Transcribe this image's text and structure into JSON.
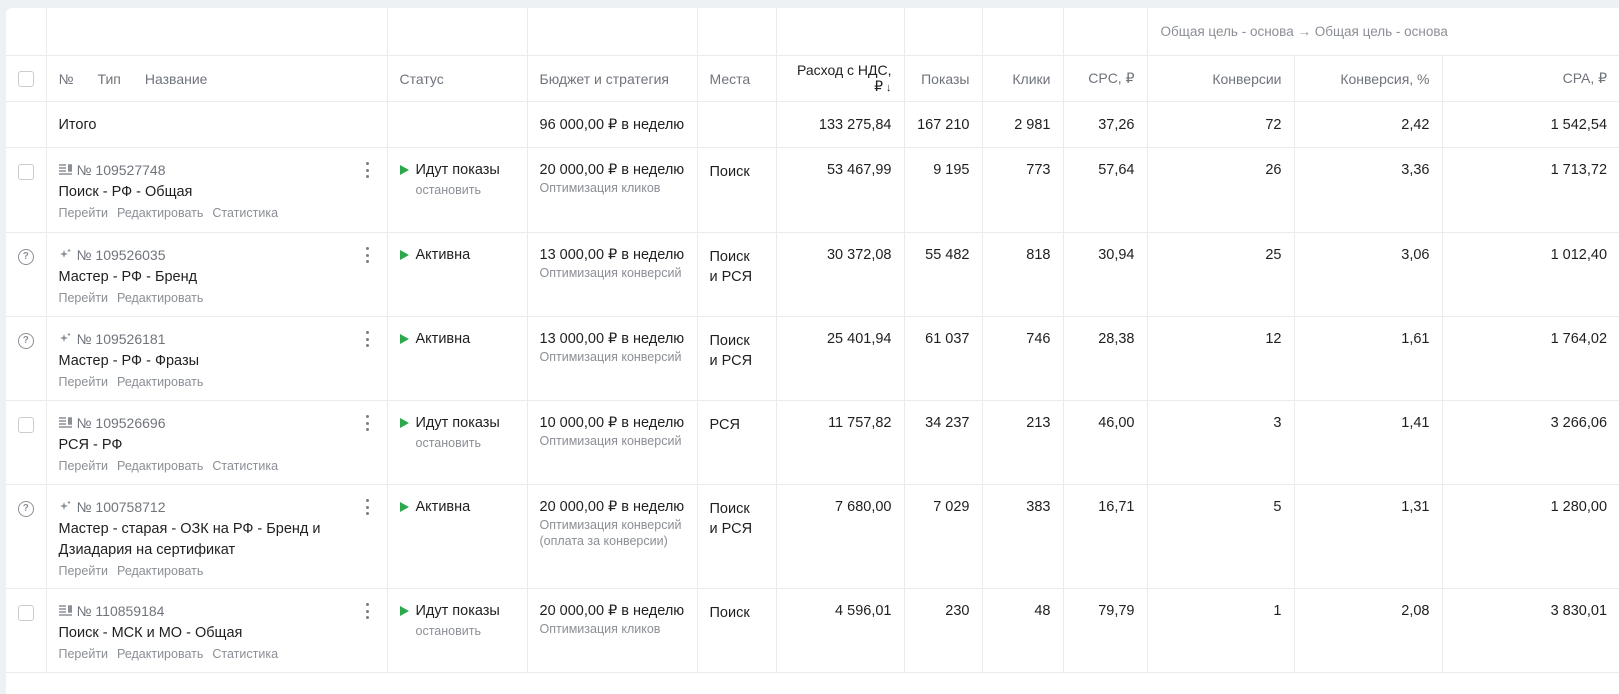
{
  "goal_header": "Общая цель - основа → Общая цель - основа",
  "columns": {
    "number": "№",
    "type": "Тип",
    "name": "Название",
    "status": "Статус",
    "budget": "Бюджет и стратегия",
    "places": "Места",
    "spend": "Расход с НДС, ₽",
    "spend_sort_icon": "↓",
    "impressions": "Показы",
    "clicks": "Клики",
    "cpc": "CPC, ₽",
    "conversions": "Конверсии",
    "conversion_rate": "Конверсия, %",
    "cpa": "CPA, ₽"
  },
  "total": {
    "label": "Итого",
    "budget": "96 000,00 ₽ в неделю",
    "spend": "133 275,84",
    "impressions": "167 210",
    "clicks": "2 981",
    "cpc": "37,26",
    "conversions": "72",
    "conversion_rate": "2,42",
    "cpa": "1 542,54"
  },
  "campaigns": [
    {
      "select": "checkbox",
      "type_icon": "text-campaign-icon",
      "id": "№ 109527748",
      "name": "Поиск - РФ - Общая",
      "links": [
        "Перейти",
        "Редактировать",
        "Статистика"
      ],
      "status": "Идут показы",
      "status_action": "остановить",
      "budget": "20 000,00 ₽ в неделю",
      "strategy": "Оптимизация кликов",
      "places": "Поиск",
      "spend": "53 467,99",
      "impressions": "9 195",
      "clicks": "773",
      "cpc": "57,64",
      "conversions": "26",
      "conversion_rate": "3,36",
      "cpa": "1 713,72"
    },
    {
      "select": "help",
      "type_icon": "master-campaign-icon",
      "id": "№ 109526035",
      "name": "Мастер - РФ - Бренд",
      "links": [
        "Перейти",
        "Редактировать"
      ],
      "status": "Активна",
      "status_action": "",
      "budget": "13 000,00 ₽ в неделю",
      "strategy": "Оптимизация конверсий",
      "places": "Поиск\nи РСЯ",
      "spend": "30 372,08",
      "impressions": "55 482",
      "clicks": "818",
      "cpc": "30,94",
      "conversions": "25",
      "conversion_rate": "3,06",
      "cpa": "1 012,40"
    },
    {
      "select": "help",
      "type_icon": "master-campaign-icon",
      "id": "№ 109526181",
      "name": "Мастер - РФ - Фразы",
      "links": [
        "Перейти",
        "Редактировать"
      ],
      "status": "Активна",
      "status_action": "",
      "budget": "13 000,00 ₽ в неделю",
      "strategy": "Оптимизация конверсий",
      "places": "Поиск\nи РСЯ",
      "spend": "25 401,94",
      "impressions": "61 037",
      "clicks": "746",
      "cpc": "28,38",
      "conversions": "12",
      "conversion_rate": "1,61",
      "cpa": "1 764,02"
    },
    {
      "select": "checkbox",
      "type_icon": "text-campaign-icon",
      "id": "№ 109526696",
      "name": "РСЯ - РФ",
      "links": [
        "Перейти",
        "Редактировать",
        "Статистика"
      ],
      "status": "Идут показы",
      "status_action": "остановить",
      "budget": "10 000,00 ₽ в неделю",
      "strategy": "Оптимизация конверсий",
      "places": "РСЯ",
      "spend": "11 757,82",
      "impressions": "34 237",
      "clicks": "213",
      "cpc": "46,00",
      "conversions": "3",
      "conversion_rate": "1,41",
      "cpa": "3 266,06"
    },
    {
      "select": "help",
      "type_icon": "master-campaign-icon",
      "id": "№ 100758712",
      "name": "Мастер - старая - ОЗК на РФ - Бренд и Дзиадария на сертификат",
      "links": [
        "Перейти",
        "Редактировать"
      ],
      "status": "Активна",
      "status_action": "",
      "budget": "20 000,00 ₽ в неделю",
      "strategy": "Оптимизация конверсий\n(оплата за конверсии)",
      "places": "Поиск\nи РСЯ",
      "spend": "7 680,00",
      "impressions": "7 029",
      "clicks": "383",
      "cpc": "16,71",
      "conversions": "5",
      "conversion_rate": "1,31",
      "cpa": "1 280,00"
    },
    {
      "select": "checkbox",
      "type_icon": "text-campaign-icon",
      "id": "№ 110859184",
      "name": "Поиск - МСК и МО - Общая",
      "links": [
        "Перейти",
        "Редактировать",
        "Статистика"
      ],
      "status": "Идут показы",
      "status_action": "остановить",
      "budget": "20 000,00 ₽ в неделю",
      "strategy": "Оптимизация кликов",
      "places": "Поиск",
      "spend": "4 596,01",
      "impressions": "230",
      "clicks": "48",
      "cpc": "79,79",
      "conversions": "1",
      "conversion_rate": "2,08",
      "cpa": "3 830,01"
    }
  ],
  "colors": {
    "status_play": "#2aa84a",
    "muted_text": "#8b8f96",
    "grid_line": "#e9ecef"
  }
}
